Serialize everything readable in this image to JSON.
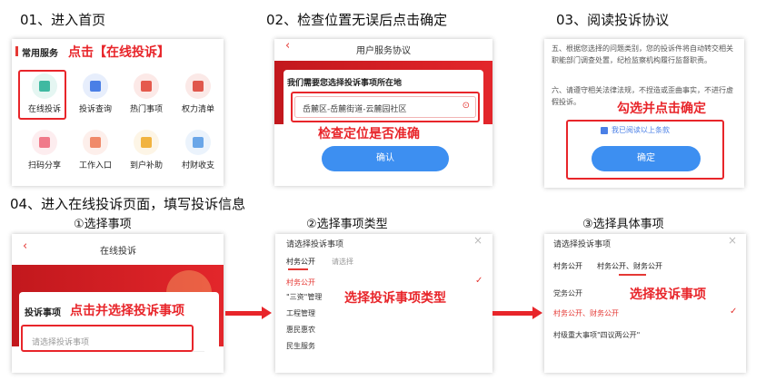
{
  "steps": {
    "s1": "01、进入首页",
    "s2": "02、检查位置无误后点击确定",
    "s3": "03、阅读投诉协议",
    "s4": "04、进入在线投诉页面，填写投诉信息",
    "sub1": "①选择事项",
    "sub2": "②选择事项类型",
    "sub3": "③选择具体事项"
  },
  "panel1": {
    "heading": "常用服务",
    "note": "点击【在线投诉】",
    "services": [
      {
        "label": "在线投诉",
        "icon": "complaint-icon",
        "color": "#3fb9a1"
      },
      {
        "label": "投诉查询",
        "icon": "query-icon",
        "color": "#4a7fe6"
      },
      {
        "label": "热门事项",
        "icon": "fire-icon",
        "color": "#e55a4d"
      },
      {
        "label": "权力清单",
        "icon": "checklist-icon",
        "color": "#e0574c"
      },
      {
        "label": "扫码分享",
        "icon": "qr-icon",
        "color": "#f07a8a"
      },
      {
        "label": "工作入口",
        "icon": "entrance-icon",
        "color": "#f08a6a"
      },
      {
        "label": "到户补助",
        "icon": "subsidy-icon",
        "color": "#f1b340"
      },
      {
        "label": "村财收支",
        "icon": "finance-icon",
        "color": "#6aa6e8"
      }
    ]
  },
  "panel2": {
    "back": "‹",
    "title": "用户服务协议",
    "banner": "我们需要您选择投诉事项所在地",
    "location": "岳麓区-岳麓街道-云麓园社区",
    "note": "检查定位是否准确",
    "confirm": "确认"
  },
  "panel3": {
    "text1": "五、根据您选择的问题类别，您的投诉件将自动转交相关职能部门调查处置，纪检监察机构履行监督职责。",
    "text2": "六、请遵守相关法律法规，不捏造或歪曲事实，不进行虚假投诉。",
    "note": "勾选并点击确定",
    "agree": "我已阅读以上条款",
    "confirm": "确定"
  },
  "panel4": {
    "back": "‹",
    "title": "在线投诉",
    "field_label": "投诉事项",
    "placeholder": "请选择投诉事项",
    "note": "点击并选择投诉事项"
  },
  "panel5": {
    "title": "请选择投诉事项",
    "tab_active": "村务公开",
    "tab_other": "请选择",
    "items": [
      "村务公开",
      "\"三资\"管理",
      "工程管理",
      "惠民惠农",
      "民生服务"
    ],
    "note": "选择投诉事项类型",
    "close": "×",
    "check": "✓"
  },
  "panel6": {
    "title": "请选择投诉事项",
    "tab1": "村务公开",
    "tab2": "村务公开、财务公开",
    "items": [
      "党务公开",
      "村务公开、财务公开",
      "村级重大事项\"四议两公开\""
    ],
    "note": "选择投诉事项",
    "close": "×",
    "check": "✓"
  }
}
